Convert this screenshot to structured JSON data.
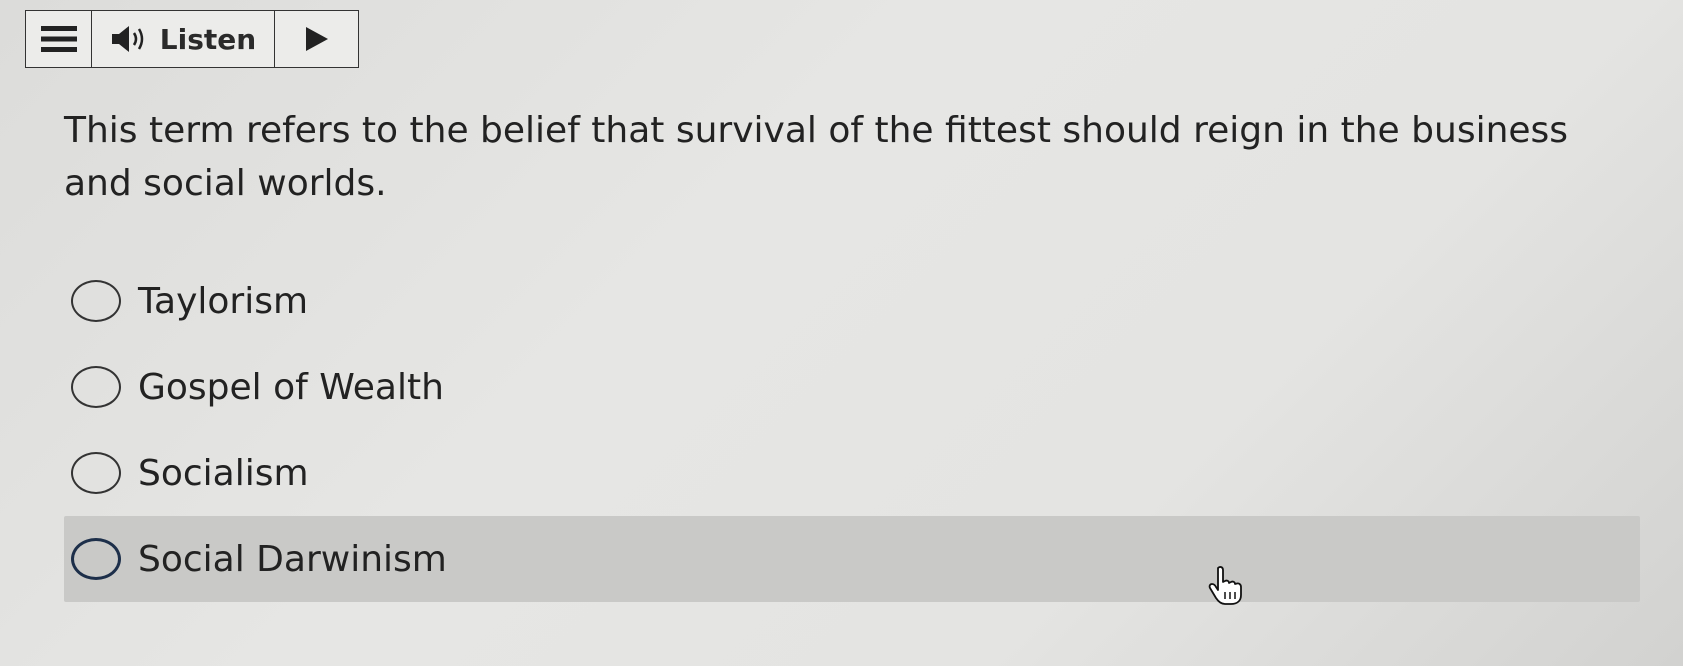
{
  "toolbar": {
    "menu_icon": "hamburger-menu-icon",
    "speaker_icon": "speaker-icon",
    "listen_label": "Listen",
    "play_icon": "play-icon"
  },
  "question": {
    "text": "This term refers to the belief that survival of the fittest should reign in the business and social worlds."
  },
  "options": [
    {
      "label": "Taylorism",
      "hovered": false
    },
    {
      "label": "Gospel of Wealth",
      "hovered": false
    },
    {
      "label": "Socialism",
      "hovered": false
    },
    {
      "label": "Social Darwinism",
      "hovered": true
    }
  ],
  "colors": {
    "hover_background": "#c9c9c7",
    "hover_radio_border": "#1d2f4a",
    "text": "#222222"
  }
}
